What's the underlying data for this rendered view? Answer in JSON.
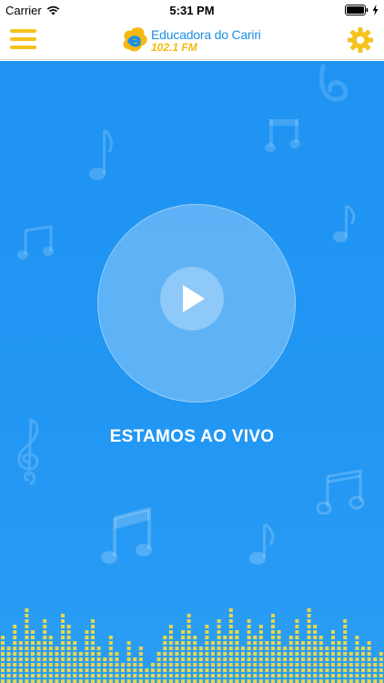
{
  "status_bar": {
    "carrier": "Carrier",
    "time": "5:31 PM"
  },
  "header": {
    "logo_title": "Educadora do Cariri",
    "logo_frequency": "102.1 FM"
  },
  "player": {
    "status_text": "ESTAMOS AO VIVO"
  },
  "icons": {
    "menu": "hamburger-menu-icon",
    "settings": "gear-icon",
    "play": "play-icon",
    "wifi": "wifi-icon",
    "battery": "battery-icon"
  },
  "colors": {
    "accent_yellow": "#f6c21c",
    "brand_blue": "#1b8fe3",
    "background_blue": "#2196f3",
    "equalizer_bar": "#e9d64a"
  }
}
